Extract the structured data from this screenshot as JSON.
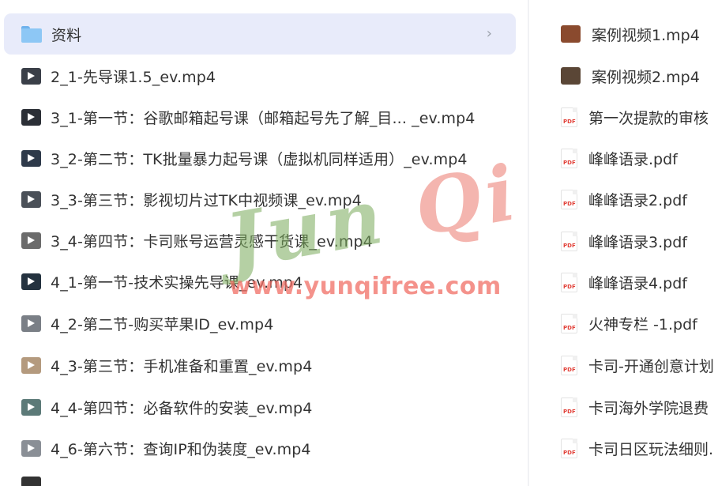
{
  "left_items": [
    {
      "label": "资料",
      "type": "folder",
      "selected": true
    },
    {
      "label": "2_1-先导课1.5_ev.mp4",
      "type": "video",
      "thumb": "#3a3f48"
    },
    {
      "label": "3_1-第一节：谷歌邮箱起号课（邮箱起号先了解_目... _ev.mp4",
      "type": "video",
      "thumb": "#2b2f36"
    },
    {
      "label": "3_2-第二节：TK批量暴力起号课（虚拟机同样适用）_ev.mp4",
      "type": "video",
      "thumb": "#2e3a4a"
    },
    {
      "label": "3_3-第三节：影视切片过TK中视频课_ev.mp4",
      "type": "video",
      "thumb": "#4a5058"
    },
    {
      "label": "3_4-第四节：卡司账号运营灵感干货课_ev.mp4",
      "type": "video",
      "thumb": "#6b6b6b"
    },
    {
      "label": "4_1-第一节-技术实操先导课_ev.mp4",
      "type": "video",
      "thumb": "#24323f"
    },
    {
      "label": "4_2-第二节-购买苹果ID_ev.mp4",
      "type": "video",
      "thumb": "#7a7f86"
    },
    {
      "label": "4_3-第三节：手机准备和重置_ev.mp4",
      "type": "video",
      "thumb": "#b49a7e"
    },
    {
      "label": "4_4-第四节：必备软件的安装_ev.mp4",
      "type": "video",
      "thumb": "#5c7a78"
    },
    {
      "label": "4_6-第六节：查询IP和伪装度_ev.mp4",
      "type": "video",
      "thumb": "#8a8f96"
    }
  ],
  "right_items": [
    {
      "label": "案例视频1.mp4",
      "type": "video",
      "thumb": "#8a4a2e"
    },
    {
      "label": "案例视频2.mp4",
      "type": "video",
      "thumb": "#5a4636"
    },
    {
      "label": "第一次提款的审核",
      "type": "pdf"
    },
    {
      "label": "峰峰语录.pdf",
      "type": "pdf"
    },
    {
      "label": "峰峰语录2.pdf",
      "type": "pdf"
    },
    {
      "label": "峰峰语录3.pdf",
      "type": "pdf"
    },
    {
      "label": "峰峰语录4.pdf",
      "type": "pdf"
    },
    {
      "label": "火神专栏 -1.pdf",
      "type": "pdf"
    },
    {
      "label": "卡司-开通创意计划",
      "type": "pdf"
    },
    {
      "label": "卡司海外学院退费",
      "type": "pdf"
    },
    {
      "label": "卡司日区玩法细则.",
      "type": "pdf"
    }
  ],
  "pdf_badge": "PDF",
  "chevron_glyph": "›",
  "watermark": {
    "brand_a": "Jun",
    "brand_b": "Qi",
    "url": "www.yunqifree.com"
  },
  "colors": {
    "selected_bg": "#e8ebfa",
    "folder": "#8dc7f5",
    "pdf_red": "#e2433b"
  }
}
